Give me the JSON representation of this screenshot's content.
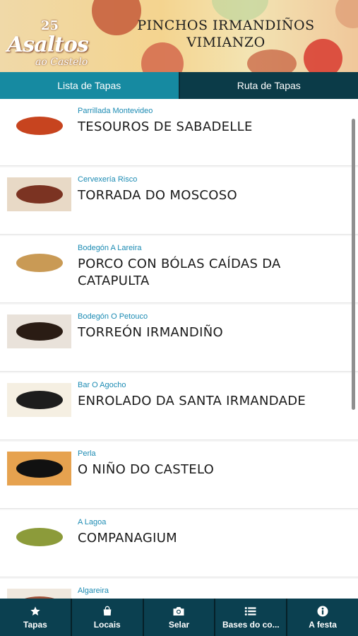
{
  "header": {
    "logo_number": "25",
    "logo_main": "Asaltos",
    "logo_sub": "ao Castelo",
    "title_line1": "PINCHOS IRMANDIÑOS",
    "title_line2": "VIMIANZO"
  },
  "tabs": [
    {
      "label": "Lista de Tapas",
      "active": true
    },
    {
      "label": "Ruta de Tapas",
      "active": false
    }
  ],
  "list": {
    "items": [
      {
        "bar": "Parrillada Montevideo",
        "tapa": "TESOUROS DE SABADELLE",
        "dish_color": "#c7441f",
        "plate_color": "#ffffff"
      },
      {
        "bar": "Cervexería Risco",
        "tapa": "TORRADA DO MOSCOSO",
        "dish_color": "#7b3322",
        "plate_color": "#e8d9c6"
      },
      {
        "bar": "Bodegón A Lareira",
        "tapa": "PORCO CON BÓLAS CAÍDAS DA CATAPULTA",
        "dish_color": "#c99a55",
        "plate_color": "#ffffff"
      },
      {
        "bar": "Bodegón O Petouco",
        "tapa": "TORREÓN IRMANDIÑO",
        "dish_color": "#2a1c14",
        "plate_color": "#e9e2da"
      },
      {
        "bar": "Bar O Agocho",
        "tapa": "ENROLADO DA SANTA IRMANDADE",
        "dish_color": "#1d1d1d",
        "plate_color": "#f5efe2"
      },
      {
        "bar": "Perla",
        "tapa": "O NIÑO DO CASTELO",
        "dish_color": "#111111",
        "plate_color": "#e6a24f"
      },
      {
        "bar": "A Lagoa",
        "tapa": "COMPANAGIUM",
        "dish_color": "#8c9b3a",
        "plate_color": "#ffffff"
      },
      {
        "bar": "Algareira",
        "tapa": "",
        "dish_color": "#a0523a",
        "plate_color": "#f0e8de"
      }
    ]
  },
  "bottom_nav": [
    {
      "label": "Tapas",
      "icon": "star-icon"
    },
    {
      "label": "Locais",
      "icon": "bag-icon"
    },
    {
      "label": "Selar",
      "icon": "camera-icon"
    },
    {
      "label": "Bases do co...",
      "icon": "list-icon"
    },
    {
      "label": "A festa",
      "icon": "info-icon"
    }
  ],
  "colors": {
    "accent_tab": "#168aa1",
    "dark_teal": "#0b3b48",
    "bar_name": "#1c8bb3"
  }
}
